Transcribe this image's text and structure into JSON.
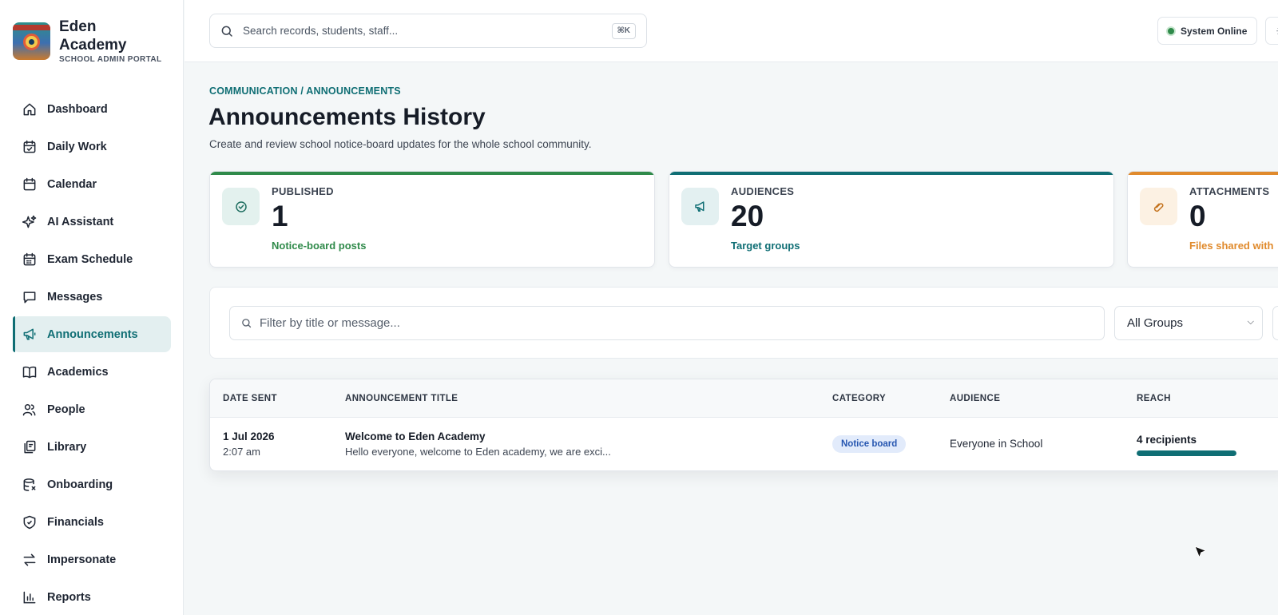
{
  "brand": {
    "name": "Eden Academy",
    "subtitle": "SCHOOL ADMIN PORTAL"
  },
  "sidebar": {
    "items": [
      {
        "label": "Dashboard",
        "icon": "home-icon",
        "active": false
      },
      {
        "label": "Daily Work",
        "icon": "calendar-check-icon",
        "active": false
      },
      {
        "label": "Calendar",
        "icon": "calendar-icon",
        "active": false
      },
      {
        "label": "AI Assistant",
        "icon": "sparkles-icon",
        "active": false
      },
      {
        "label": "Exam Schedule",
        "icon": "calendar-grid-icon",
        "active": false
      },
      {
        "label": "Messages",
        "icon": "message-icon",
        "active": false
      },
      {
        "label": "Announcements",
        "icon": "megaphone-icon",
        "active": true
      },
      {
        "label": "Academics",
        "icon": "book-icon",
        "active": false
      },
      {
        "label": "People",
        "icon": "users-icon",
        "active": false
      },
      {
        "label": "Library",
        "icon": "library-icon",
        "active": false
      },
      {
        "label": "Onboarding",
        "icon": "database-icon",
        "active": false
      },
      {
        "label": "Financials",
        "icon": "shield-icon",
        "active": false
      },
      {
        "label": "Impersonate",
        "icon": "swap-icon",
        "active": false
      },
      {
        "label": "Reports",
        "icon": "bar-chart-icon",
        "active": false
      }
    ]
  },
  "topbar": {
    "search_placeholder": "Search records, students, staff...",
    "shortcut": "⌘K",
    "status": "System Online"
  },
  "header": {
    "breadcrumb": "COMMUNICATION / ANNOUNCEMENTS",
    "title": "Announcements History",
    "subtitle": "Create and review school notice-board updates for the whole school community."
  },
  "stats": [
    {
      "label": "PUBLISHED",
      "value": "1",
      "caption": "Notice-board posts",
      "color": "#2f8a4a",
      "icon": "check-circle-icon"
    },
    {
      "label": "AUDIENCES",
      "value": "20",
      "caption": "Target groups",
      "color": "#0f6e74",
      "icon": "megaphone-icon"
    },
    {
      "label": "ATTACHMENTS",
      "value": "0",
      "caption": "Files shared with",
      "color": "#e08a2c",
      "icon": "paperclip-icon"
    }
  ],
  "filter": {
    "placeholder": "Filter by title or message...",
    "group_selected": "All Groups"
  },
  "table": {
    "headers": [
      "DATE SENT",
      "ANNOUNCEMENT TITLE",
      "CATEGORY",
      "AUDIENCE",
      "REACH"
    ],
    "rows": [
      {
        "date": "1 Jul 2026",
        "time": "2:07 am",
        "title": "Welcome to Eden Academy",
        "message": "Hello everyone, welcome to Eden academy, we are exci...",
        "category": "Notice board",
        "audience": "Everyone in School",
        "reach": "4 recipients",
        "reach_fraction": 1.0
      }
    ]
  }
}
